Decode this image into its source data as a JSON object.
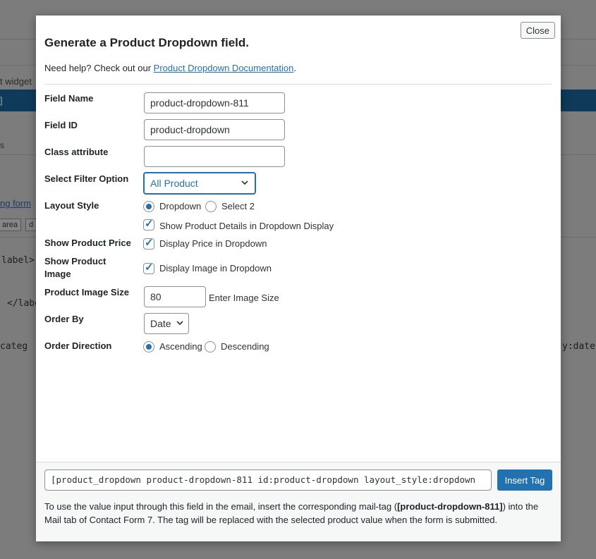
{
  "background": {
    "widget_text": "t widget",
    "bracket_text": "]",
    "tab_text": "s",
    "link_text": "ng form",
    "area_btn": "area",
    "d_btn": "d",
    "label_open": "label>",
    "label_close": "</labe",
    "categ_text": "categ",
    "date_text": "y:date"
  },
  "dialog": {
    "close_label": "Close",
    "title": "Generate a Product Dropdown field.",
    "help_prefix": "Need help? Check out our ",
    "help_link": "Product Dropdown Documentation",
    "help_suffix": "."
  },
  "form": {
    "field_name": {
      "label": "Field Name",
      "value": "product-dropdown-811"
    },
    "field_id": {
      "label": "Field ID",
      "value": "product-dropdown"
    },
    "class_attr": {
      "label": "Class attribute",
      "value": ""
    },
    "filter": {
      "label": "Select Filter Option",
      "value": "All Product"
    },
    "layout": {
      "label": "Layout Style",
      "options": [
        "Dropdown",
        "Select 2"
      ],
      "selected": "Dropdown",
      "details_checkbox": "Show Product Details in Dropdown Display"
    },
    "price": {
      "label": "Show Product Price",
      "checkbox": "Display Price in Dropdown"
    },
    "image": {
      "label_line1": "Show Product",
      "label_line2": "Image",
      "checkbox": "Display Image in Dropdown"
    },
    "image_size": {
      "label": "Product Image Size",
      "value": "80",
      "hint": "Enter Image Size"
    },
    "order_by": {
      "label": "Order By",
      "value": "Date"
    },
    "order_dir": {
      "label": "Order Direction",
      "options": [
        "Ascending",
        "Descending"
      ],
      "selected": "Ascending"
    }
  },
  "footer": {
    "tag_value": "[product_dropdown product-dropdown-811 id:product-dropdown layout_style:dropdown",
    "insert_label": "Insert Tag",
    "note_part1": "To use the value input through this field in the email, insert the corresponding mail-tag (",
    "note_tag": "[product-dropdown-811]",
    "note_part2": ") into the Mail tab of Contact Form 7. The tag will be replaced with the selected product value when the form is submitted."
  },
  "colors": {
    "accent": "#2271b1",
    "overlay": "#7c7c7c"
  }
}
